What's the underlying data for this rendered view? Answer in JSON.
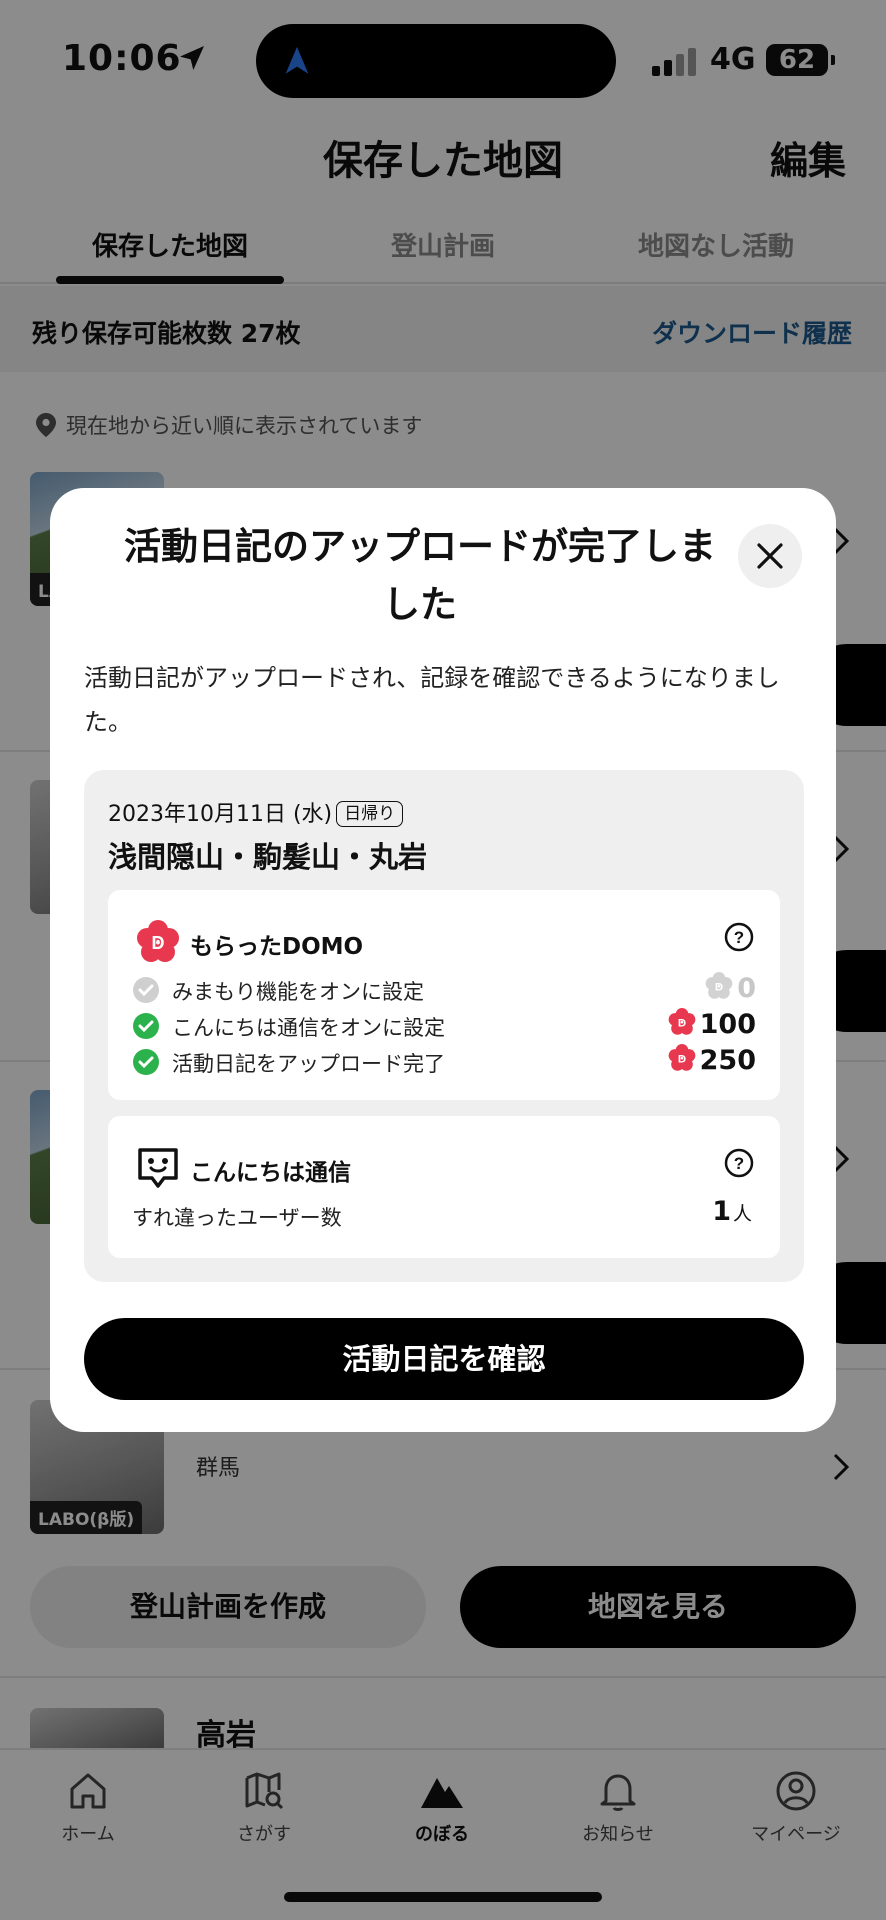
{
  "status_bar": {
    "time": "10:06",
    "network": "4G",
    "battery": "62"
  },
  "header": {
    "title": "保存した地図",
    "edit_label": "編集"
  },
  "tabs": [
    {
      "label": "保存した地図",
      "active": true
    },
    {
      "label": "登山計画",
      "active": false
    },
    {
      "label": "地図なし活動",
      "active": false
    }
  ],
  "storage": {
    "remaining_text": "残り保存可能枚数 27枚",
    "history_link": "ダウンロード履歴"
  },
  "location_note": "現在地から近い順に表示されています",
  "list": {
    "item1": {
      "title": "浅間隠山・駒髪山・丸岩",
      "badge": "LABO(β版)"
    },
    "item4": {
      "title": "",
      "region": "群馬",
      "badge": "LABO(β版)"
    },
    "item5": {
      "title": "高岩"
    },
    "create_plan_button": "登山計画を作成",
    "view_map_button": "地図を見る"
  },
  "modal": {
    "title": "活動日記のアップロードが完了しました",
    "description": "活動日記がアップロードされ、記録を確認できるようになりました。",
    "date": "2023年10月11日 (水)",
    "day_tag": "日帰り",
    "route": "浅間隠山・駒髪山・丸岩",
    "domo": {
      "header": "もらったDOMO",
      "rows": [
        {
          "label": "みまもり機能をオンに設定",
          "points": "0",
          "done": false
        },
        {
          "label": "こんにちは通信をオンに設定",
          "points": "100",
          "done": true
        },
        {
          "label": "活動日記をアップロード完了",
          "points": "250",
          "done": true
        }
      ]
    },
    "hello": {
      "header": "こんにちは通信",
      "passed_label": "すれ違ったユーザー数",
      "passed_count": "1",
      "passed_unit": "人"
    },
    "confirm_button": "活動日記を確認"
  },
  "tabbar": [
    {
      "label": "ホーム",
      "icon": "home-icon"
    },
    {
      "label": "さがす",
      "icon": "map-search-icon"
    },
    {
      "label": "のぼる",
      "icon": "mountain-icon",
      "active": true
    },
    {
      "label": "お知らせ",
      "icon": "bell-icon"
    },
    {
      "label": "マイページ",
      "icon": "user-icon"
    }
  ],
  "colors": {
    "accent_green": "#2bb24c",
    "domo_red": "#e8384f",
    "link_blue": "#1e5a8c"
  }
}
